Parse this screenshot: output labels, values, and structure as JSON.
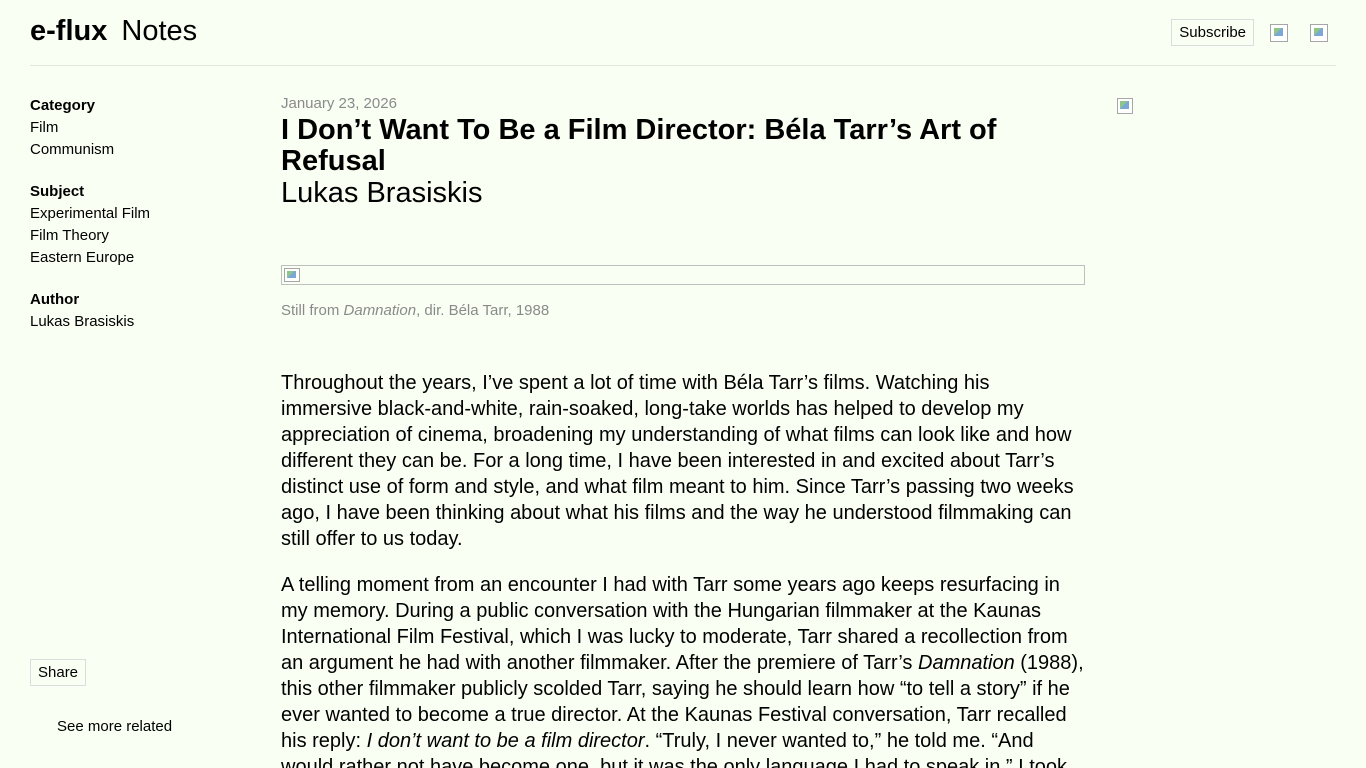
{
  "header": {
    "brand": "e-flux",
    "section": "Notes",
    "subscribe_label": "Subscribe",
    "icons": [
      "search-icon",
      "menu-icon"
    ]
  },
  "sidebar": {
    "category": {
      "heading": "Category",
      "items": [
        "Film",
        "Communism"
      ]
    },
    "subject": {
      "heading": "Subject",
      "items": [
        "Experimental Film",
        "Film Theory",
        "Eastern Europe"
      ]
    },
    "author": {
      "heading": "Author",
      "items": [
        "Lukas Brasiskis"
      ]
    },
    "share_label": "Share",
    "see_more_label": "See more related"
  },
  "article": {
    "date": "January 23, 2026",
    "title": "I Don’t Want To Be a Film Director: Béla Tarr’s Art of Refusal",
    "author": "Lukas Brasiskis",
    "caption_prefix": "Still from ",
    "caption_italic": "Damnation",
    "caption_suffix": ", dir. Béla Tarr, 1988",
    "p1": "Throughout the years, I’ve spent a lot of time with Béla Tarr’s films. Watching his immersive black-and-white, rain-soaked, long-take worlds has helped to develop my appreciation of cinema, broadening my understanding of what films can look like and how different they can be. For a long time, I have been interested in and excited about Tarr’s distinct use of form and style, and what film meant to him. Since Tarr’s passing two weeks ago, I have been thinking about what his films and the way he understood filmmaking can still offer to us today.",
    "p2_a": "A telling moment from an encounter I had with Tarr some years ago keeps resurfacing in my memory. During a public conversation with the Hungarian filmmaker at the Kaunas International Film Festival, which I was lucky to moderate, Tarr shared a recollection from an argument he had with another filmmaker. After the premiere of Tarr’s ",
    "p2_italic1": "Damnation",
    "p2_b": " (1988), this other filmmaker publicly scolded Tarr, saying he should learn how “to tell a story” if he ever wanted to become a true director. At the Kaunas Festival conversation, Tarr recalled his reply: ",
    "p2_italic2": "I don’t want to be a film director",
    "p2_c": ". “Truly, I never wanted to,” he told me. “And would rather not have become one, but it was the only language I had to speak in.” I took"
  }
}
